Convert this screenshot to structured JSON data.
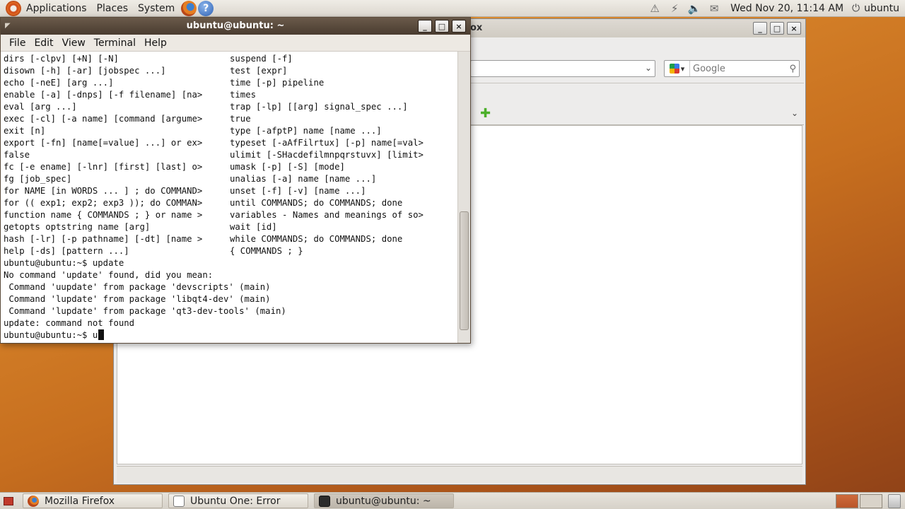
{
  "top_panel": {
    "menus": [
      "Applications",
      "Places",
      "System"
    ],
    "clock": "Wed Nov 20, 11:14 AM",
    "user": "ubuntu",
    "tray_icons": [
      "alert-icon",
      "network-icon",
      "volume-icon",
      "mail-icon"
    ]
  },
  "firefox": {
    "title_fragment": "ox",
    "search_placeholder": "Google",
    "window_buttons": [
      "_",
      "□",
      "×"
    ]
  },
  "terminal": {
    "title": "ubuntu@ubuntu: ~",
    "menus": [
      "File",
      "Edit",
      "View",
      "Terminal",
      "Help"
    ],
    "help_rows": [
      [
        "dirs [-clpv] [+N] [-N]",
        "suspend [-f]"
      ],
      [
        "disown [-h] [-ar] [jobspec ...]",
        "test [expr]"
      ],
      [
        "echo [-neE] [arg ...]",
        "time [-p] pipeline"
      ],
      [
        "enable [-a] [-dnps] [-f filename] [na>",
        "times"
      ],
      [
        "eval [arg ...]",
        "trap [-lp] [[arg] signal_spec ...]"
      ],
      [
        "exec [-cl] [-a name] [command [argume>",
        "true"
      ],
      [
        "exit [n]",
        "type [-afptP] name [name ...]"
      ],
      [
        "export [-fn] [name[=value] ...] or ex>",
        "typeset [-aAfFilrtux] [-p] name[=val>"
      ],
      [
        "false",
        "ulimit [-SHacdefilmnpqrstuvx] [limit>"
      ],
      [
        "fc [-e ename] [-lnr] [first] [last] o>",
        "umask [-p] [-S] [mode]"
      ],
      [
        "fg [job_spec]",
        "unalias [-a] name [name ...]"
      ],
      [
        "for NAME [in WORDS ... ] ; do COMMAND>",
        "unset [-f] [-v] [name ...]"
      ],
      [
        "for (( exp1; exp2; exp3 )); do COMMAN>",
        "until COMMANDS; do COMMANDS; done"
      ],
      [
        "function name { COMMANDS ; } or name >",
        "variables - Names and meanings of so>"
      ],
      [
        "getopts optstring name [arg]",
        "wait [id]"
      ],
      [
        "hash [-lr] [-p pathname] [-dt] [name >",
        "while COMMANDS; do COMMANDS; done"
      ],
      [
        "help [-ds] [pattern ...]",
        "{ COMMANDS ; }"
      ]
    ],
    "output_lines": [
      "ubuntu@ubuntu:~$ update",
      "No command 'update' found, did you mean:",
      " Command 'uupdate' from package 'devscripts' (main)",
      " Command 'lupdate' from package 'libqt4-dev' (main)",
      " Command 'lupdate' from package 'qt3-dev-tools' (main)",
      "update: command not found"
    ],
    "prompt": "ubuntu@ubuntu:~$ ",
    "current_input": "u"
  },
  "taskbar": {
    "tasks": [
      {
        "label": "Mozilla Firefox",
        "icon": "firefox-icon",
        "active": false
      },
      {
        "label": "Ubuntu One: Error",
        "icon": "window-icon",
        "active": false
      },
      {
        "label": "ubuntu@ubuntu: ~",
        "icon": "terminal-icon",
        "active": true
      }
    ]
  }
}
